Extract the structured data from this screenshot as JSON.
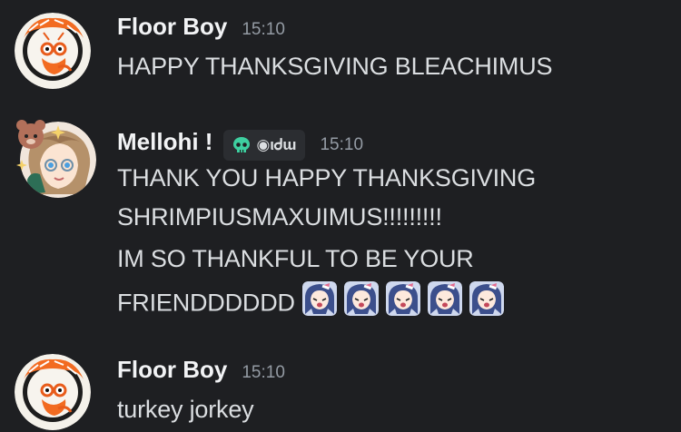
{
  "messages": [
    {
      "username": "Floor Boy",
      "timestamp": "15:10",
      "lines": [
        "HAPPY THANKSGIVING BLEACHIMUS"
      ]
    },
    {
      "username": "Mellohi !",
      "tag": "◉ιᏧɯ",
      "tag_icon": "skull-icon",
      "timestamp": "15:10",
      "lines": [
        "THANK YOU HAPPY THANKSGIVING",
        "SHRIMPIUSMAXUIMUS!!!!!!!!!",
        "IM SO THANKFUL TO BE YOUR",
        "FRIENDDDDDD"
      ],
      "emoji_count": 5,
      "emoji_name": "anime-girl-emoji"
    },
    {
      "username": "Floor Boy",
      "timestamp": "15:10",
      "lines": [
        "turkey jorkey"
      ]
    }
  ],
  "colors": {
    "background": "#1e1f22",
    "username": "#f2f3f5",
    "text": "#dbdee1",
    "timestamp": "#949ba4",
    "tag_bg": "#2b2d31",
    "tag_icon": "#3ecfa0"
  }
}
